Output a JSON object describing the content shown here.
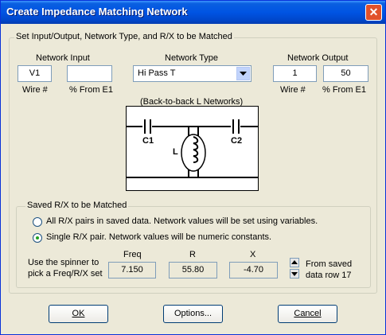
{
  "window": {
    "title": "Create Impedance Matching Network",
    "close_glyph": "✕"
  },
  "group_main": {
    "legend": "Set Input/Output, Network Type, and R/X to be Matched",
    "network_input": {
      "label": "Network Input",
      "wire_value": "V1",
      "pct_value": "",
      "wire_label": "Wire #",
      "pct_label": "% From E1"
    },
    "network_type": {
      "label": "Network Type",
      "selected": "Hi Pass T"
    },
    "network_output": {
      "label": "Network Output",
      "wire_value": "1",
      "pct_value": "50",
      "wire_label": "Wire #",
      "pct_label": "% From E1"
    },
    "diagram": {
      "caption": "(Back-to-back L Networks)",
      "c1": "C1",
      "c2": "C2",
      "l": "L"
    }
  },
  "group_saved": {
    "legend": "Saved R/X to be Matched",
    "option_all": "All R/X pairs in saved data.  Network values will be set using variables.",
    "option_single": "Single R/X pair.  Network values will be numeric constants.",
    "selected_option": "single",
    "spinner_hint_1": "Use the spinner to",
    "spinner_hint_2": "pick a Freq/R/X set",
    "freq_label": "Freq",
    "r_label": "R",
    "x_label": "X",
    "freq_value": "7.150",
    "r_value": "55.80",
    "x_value": "-4.70",
    "from_saved_1": "From saved",
    "from_saved_2": "data row 17"
  },
  "buttons": {
    "ok": "OK",
    "options": "Options...",
    "cancel": "Cancel"
  }
}
